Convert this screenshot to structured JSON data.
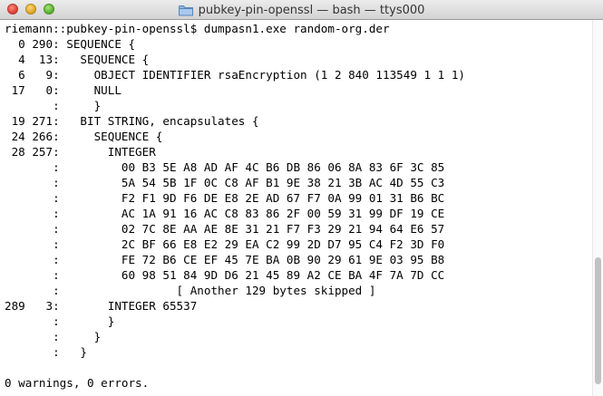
{
  "window": {
    "title": "pubkey-pin-openssl — bash — ttys000",
    "title_icon": "folder-icon"
  },
  "terminal": {
    "lines": [
      "riemann::pubkey-pin-openssl$ dumpasn1.exe random-org.der",
      "  0 290: SEQUENCE {",
      "  4  13:   SEQUENCE {",
      "  6   9:     OBJECT IDENTIFIER rsaEncryption (1 2 840 113549 1 1 1)",
      " 17   0:     NULL",
      "       :     }",
      " 19 271:   BIT STRING, encapsulates {",
      " 24 266:     SEQUENCE {",
      " 28 257:       INTEGER",
      "       :         00 B3 5E A8 AD AF 4C B6 DB 86 06 8A 83 6F 3C 85",
      "       :         5A 54 5B 1F 0C C8 AF B1 9E 38 21 3B AC 4D 55 C3",
      "       :         F2 F1 9D F6 DE E8 2E AD 67 F7 0A 99 01 31 B6 BC",
      "       :         AC 1A 91 16 AC C8 83 86 2F 00 59 31 99 DF 19 CE",
      "       :         02 7C 8E AA AE 8E 31 21 F7 F3 29 21 94 64 E6 57",
      "       :         2C BF 66 E8 E2 29 EA C2 99 2D D7 95 C4 F2 3D F0",
      "       :         FE 72 B6 CE EF 45 7E BA 0B 90 29 61 9E 03 95 B8",
      "       :         60 98 51 84 9D D6 21 45 89 A2 CE BA 4F 7A 7D CC",
      "       :                 [ Another 129 bytes skipped ]",
      "289   3:       INTEGER 65537",
      "       :       }",
      "       :     }",
      "       :   }",
      "",
      "0 warnings, 0 errors."
    ]
  },
  "colors": {
    "background": "#ffffff",
    "text": "#000000",
    "titlebar_top": "#ececec",
    "titlebar_bottom": "#d3d3d3",
    "close": "#e0443a",
    "minimize": "#e3a82a",
    "maximize": "#5fb533"
  }
}
